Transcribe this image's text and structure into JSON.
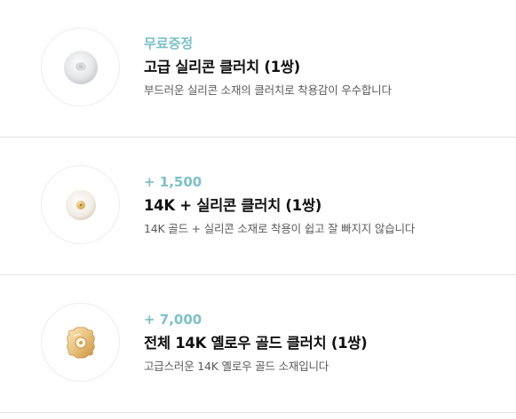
{
  "options": [
    {
      "badge": "무료증정",
      "title": "고급 실리콘 클러치 (1쌍)",
      "description": "부드러운 실리콘 소재의 클러치로 착용감이 우수합니다",
      "image_icon": "silicone-clutch-image"
    },
    {
      "badge": "+ 1,500",
      "title": "14K + 실리콘 클러치 (1쌍)",
      "description": "14K 골드 + 실리콘 소재로 착용이 쉽고 잘 빠지지 않습니다",
      "image_icon": "gold-silicone-clutch-image"
    },
    {
      "badge": "+ 7,000",
      "title": "전체 14K 옐로우 골드 클러치 (1쌍)",
      "description": "고급스러운 14K 옐로우 골드 소재입니다",
      "image_icon": "yellow-gold-clutch-image"
    }
  ],
  "colors": {
    "accent": "#7cc1c8",
    "title": "#111111",
    "description": "#5b5b5b",
    "divider": "#e2e2e2"
  }
}
